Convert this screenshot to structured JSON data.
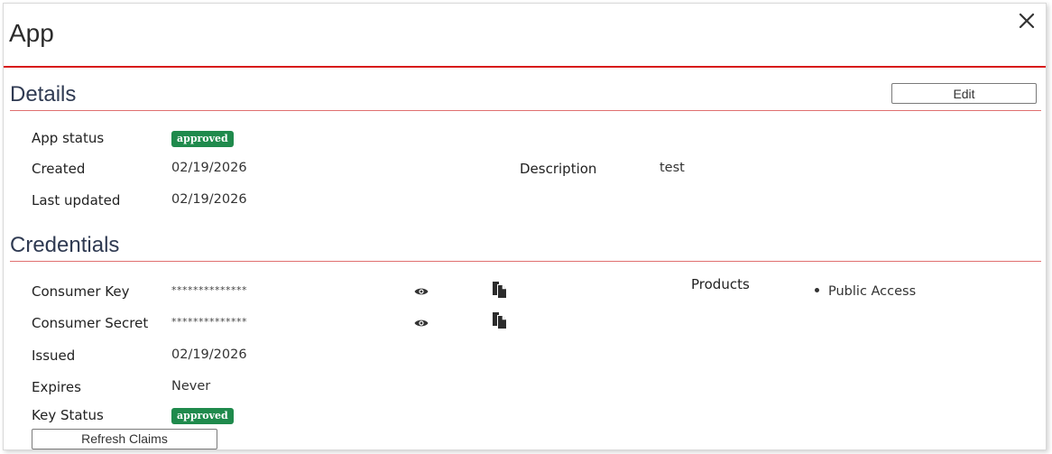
{
  "modal": {
    "title": "App"
  },
  "details": {
    "title": "Details",
    "edit_label": "Edit",
    "app_status_label": "App status",
    "app_status": "approved",
    "created_label": "Created",
    "created": "02/19/2026",
    "last_updated_label": "Last updated",
    "last_updated": "02/19/2026",
    "description_label": "Description",
    "description": "test"
  },
  "credentials": {
    "title": "Credentials",
    "consumer_key_label": "Consumer Key",
    "consumer_key": "**************",
    "consumer_secret_label": "Consumer Secret",
    "consumer_secret": "**************",
    "issued_label": "Issued",
    "issued": "02/19/2026",
    "expires_label": "Expires",
    "expires": "Never",
    "key_status_label": "Key Status",
    "key_status": "approved",
    "products_label": "Products",
    "products": [
      "Public Access"
    ],
    "refresh_label": "Refresh Claims"
  },
  "icons": {
    "close": "close-icon",
    "reveal": "eye-icon",
    "copy": "copy-icon"
  },
  "colors": {
    "accent_rule": "#d81b1b",
    "badge_green": "#1f8a4c",
    "section_title": "#2f3a52"
  }
}
